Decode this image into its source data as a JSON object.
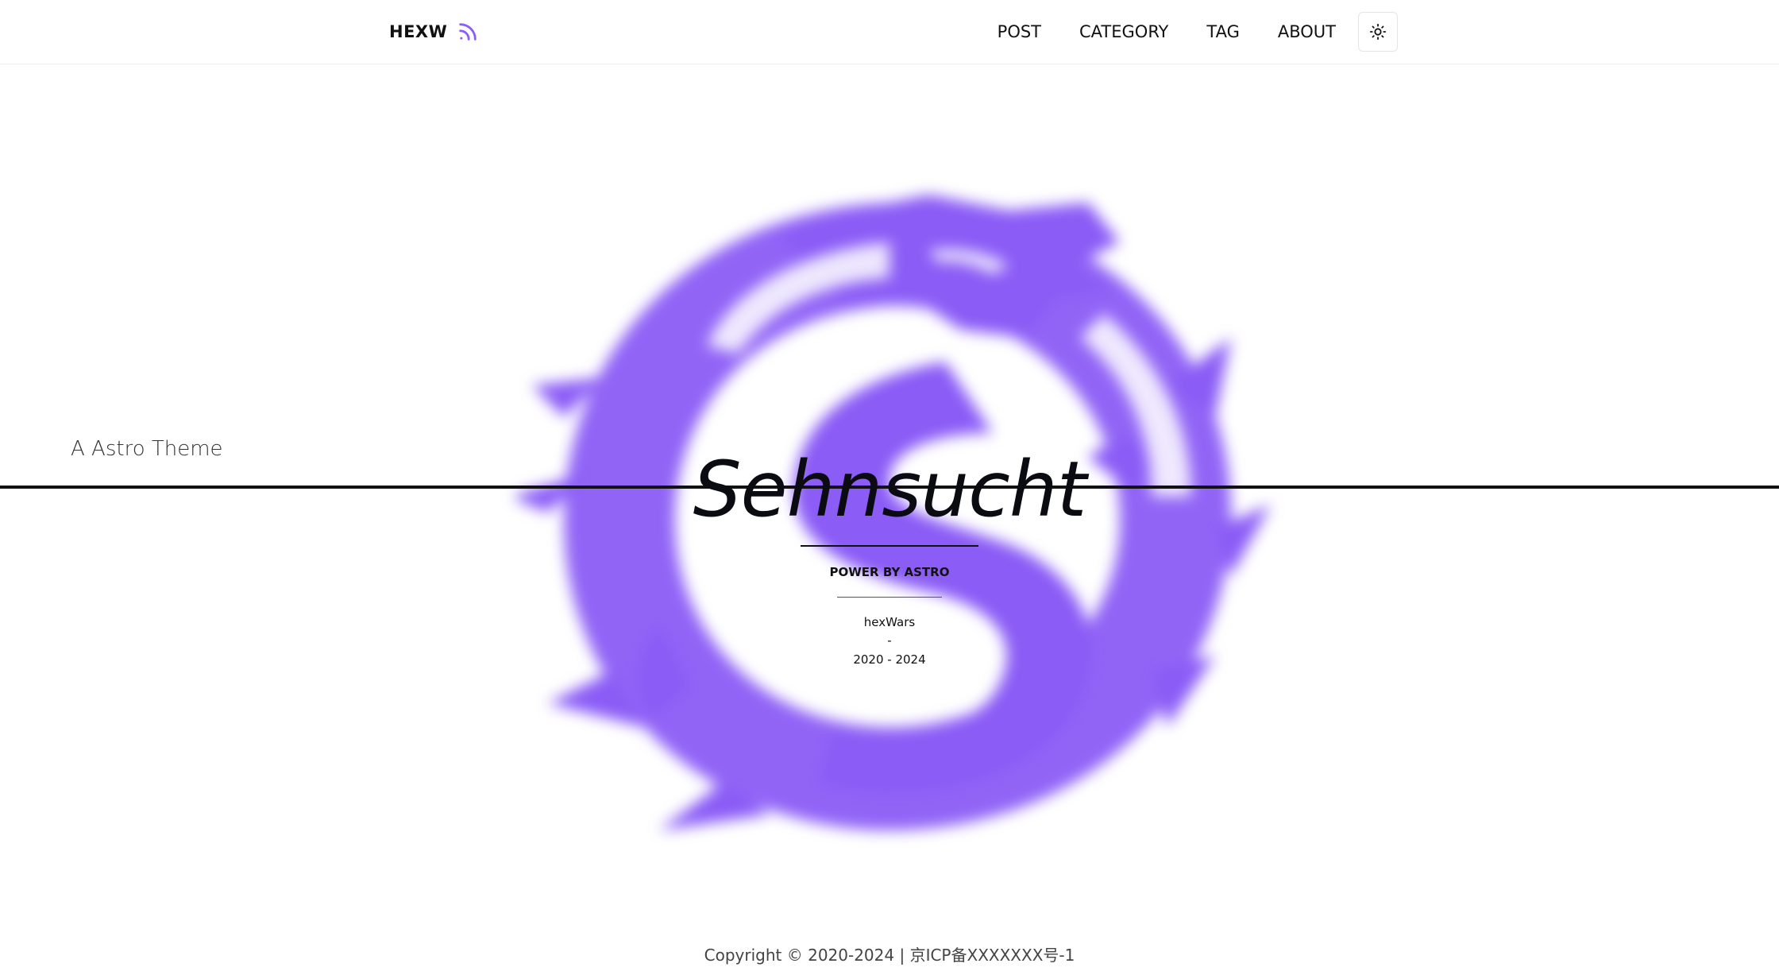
{
  "header": {
    "brand": "HEXW",
    "rss_icon": "rss-icon",
    "nav": [
      {
        "label": "POST"
      },
      {
        "label": "CATEGORY"
      },
      {
        "label": "TAG"
      },
      {
        "label": "ABOUT"
      }
    ],
    "theme_toggle_icon": "sun-icon"
  },
  "hero": {
    "tagline": "A Astro Theme",
    "title": "Sehnsucht",
    "power": "POWER BY ASTRO",
    "author": "hexWars",
    "separator": "-",
    "years": "2020 - 2024",
    "background_icon": "dragon-icon"
  },
  "footer": {
    "copyright": "Copyright © 2020-2024 | 京ICP备XXXXXXX号-1"
  },
  "colors": {
    "accent": "#8b5cf6",
    "text": "#111111"
  }
}
